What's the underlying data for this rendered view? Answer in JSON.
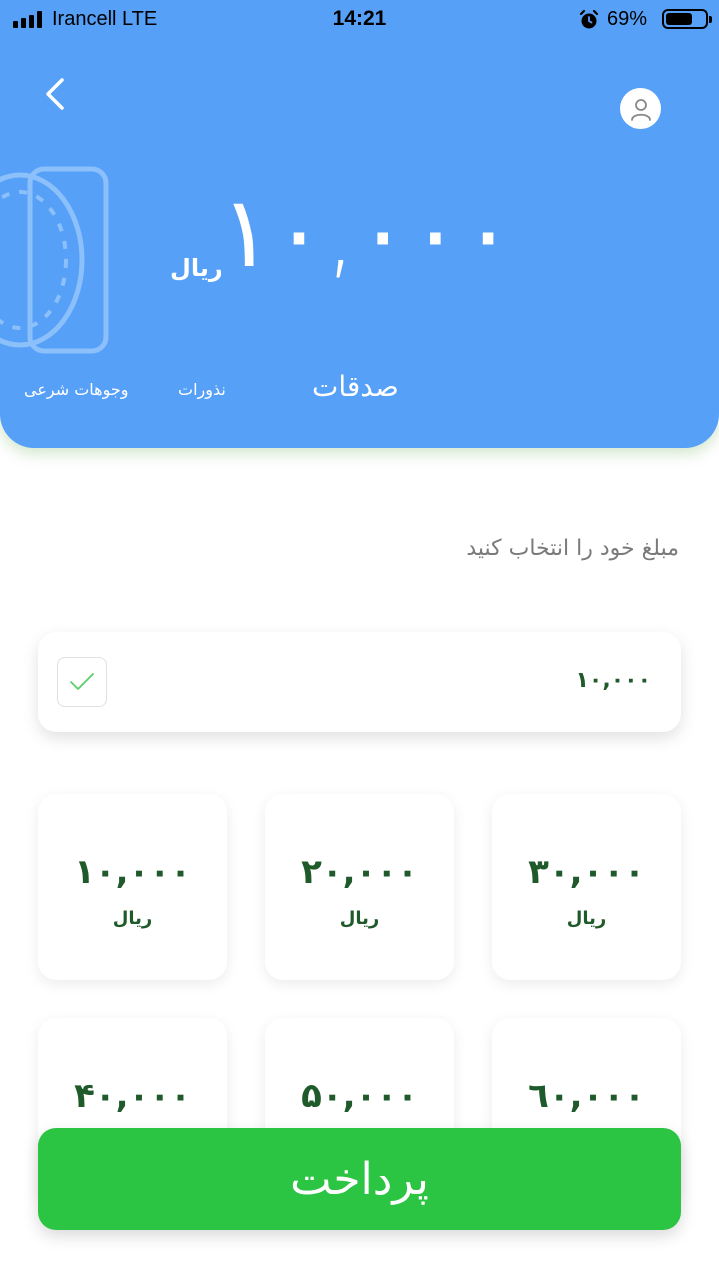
{
  "status_bar": {
    "carrier": "Irancell   LTE",
    "time": "14:21",
    "battery_percent": "69%",
    "battery_level": 0.69
  },
  "header": {
    "amount": "١٠,٠٠٠",
    "amount_unit": "ریال",
    "tabs": [
      {
        "label": "صدقات",
        "active": true
      },
      {
        "label": "نذورات",
        "active": false
      },
      {
        "label": "وجوهات شرعی",
        "active": false
      }
    ]
  },
  "selection": {
    "label": "مبلغ خود را انتخاب کنید",
    "selected_value": "١٠,٠٠٠"
  },
  "amount_options": [
    {
      "value": "٣٠,٠٠٠",
      "unit": "ریال"
    },
    {
      "value": "٢٠,٠٠٠",
      "unit": "ریال"
    },
    {
      "value": "١٠,٠٠٠",
      "unit": "ریال"
    },
    {
      "value": "٦٠,٠٠٠",
      "unit": ""
    },
    {
      "value": "۵٠,٠٠٠",
      "unit": ""
    },
    {
      "value": "۴٠,٠٠٠",
      "unit": ""
    }
  ],
  "pay_button": {
    "label": "پرداخت"
  },
  "icons": {
    "back": "chevron-left-icon",
    "profile": "user-icon",
    "coin": "coin-icon",
    "check": "check-icon",
    "alarm": "alarm-icon"
  },
  "colors": {
    "header_bg": "#56a0f8",
    "pay_button": "#2bc443",
    "amount_text": "#1f5a2a",
    "check": "#5ccf6a"
  }
}
